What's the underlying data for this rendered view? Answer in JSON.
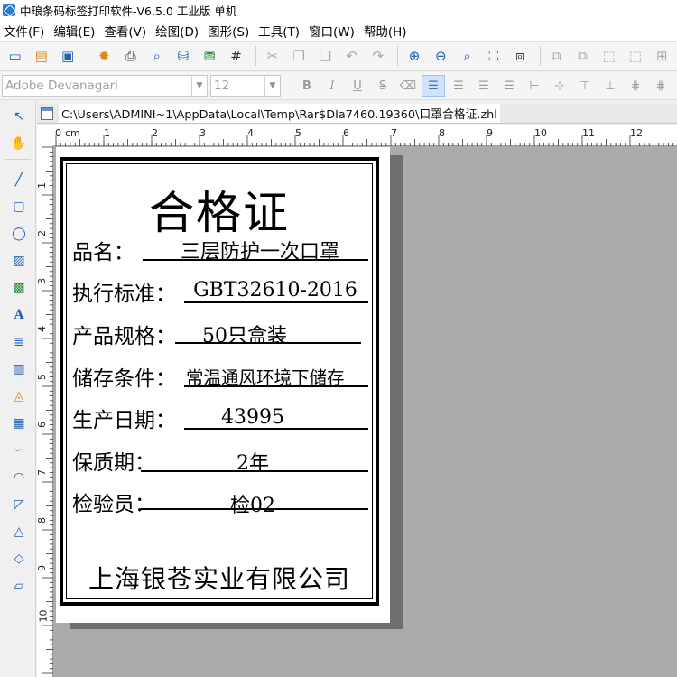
{
  "window": {
    "title": "中琅条码标签打印软件-V6.5.0 工业版 单机"
  },
  "menu": [
    {
      "label": "文件(F)"
    },
    {
      "label": "编辑(E)"
    },
    {
      "label": "查看(V)"
    },
    {
      "label": "绘图(D)"
    },
    {
      "label": "图形(S)"
    },
    {
      "label": "工具(T)"
    },
    {
      "label": "窗口(W)"
    },
    {
      "label": "帮助(H)"
    }
  ],
  "format_bar": {
    "font_family": "Adobe Devanagari",
    "font_size": "12",
    "bold": "B",
    "italic": "I",
    "underline": "U",
    "strike": "S"
  },
  "document": {
    "path": "C:\\Users\\ADMINI~1\\AppData\\Local\\Temp\\Rar$DIa7460.19360\\口罩合格证.zhl"
  },
  "ruler": {
    "unit": "cm",
    "h_ticks": [
      "0",
      "1",
      "2",
      "3",
      "4",
      "5",
      "6",
      "7",
      "8",
      "9",
      "10",
      "11",
      "12"
    ],
    "v_ticks": [
      "1",
      "2",
      "3",
      "4",
      "5",
      "6",
      "7",
      "8",
      "9",
      "10"
    ]
  },
  "label": {
    "title": "合格证",
    "fields": [
      {
        "name": "品名：",
        "value": "三层防护一次口罩"
      },
      {
        "name": "执行标准：",
        "value": "GBT32610-2016"
      },
      {
        "name": "产品规格：",
        "value": "50只盒装"
      },
      {
        "name": "储存条件：",
        "value": "常温通风环境下储存"
      },
      {
        "name": "生产日期：",
        "value": "43995"
      },
      {
        "name": "保质期：",
        "value": "2年"
      },
      {
        "name": "检验员：",
        "value": "检02"
      }
    ],
    "company": "上海银苍实业有限公司"
  },
  "colors": {
    "accent": "#2b7bd8",
    "canvas_bg": "#ababab",
    "paper_shadow": "#6f6f6f"
  }
}
